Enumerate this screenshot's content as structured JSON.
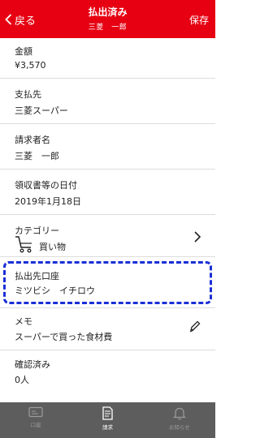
{
  "header": {
    "back_label": "戻る",
    "title": "払出済み",
    "subtitle": "三菱　一郎",
    "save_label": "保存",
    "bg_color": "#e60012"
  },
  "fields": {
    "amount": {
      "label": "金額",
      "value": "¥3,570"
    },
    "payee": {
      "label": "支払先",
      "value": "三菱スーパー"
    },
    "requester": {
      "label": "請求者名",
      "value": "三菱　一郎"
    },
    "receipt_date": {
      "label": "領収書等の日付",
      "value": "2019年1月18日"
    },
    "category": {
      "label": "カテゴリー",
      "value": "買い物",
      "icon": "shopping-cart-icon"
    },
    "account": {
      "label": "払出先口座",
      "value": "ミツビシ　イチロウ",
      "highlight_color": "#1a2fd6"
    },
    "memo": {
      "label": "メモ",
      "value": "スーパーで買った食材費"
    },
    "confirmed": {
      "label": "確認済み",
      "value": "0人"
    }
  },
  "tabbar": {
    "tabs": [
      {
        "label": "口座",
        "icon": "card-icon",
        "active": false
      },
      {
        "label": "請求",
        "icon": "document-icon",
        "active": true
      },
      {
        "label": "お知らせ",
        "icon": "bell-icon",
        "active": false
      }
    ]
  }
}
